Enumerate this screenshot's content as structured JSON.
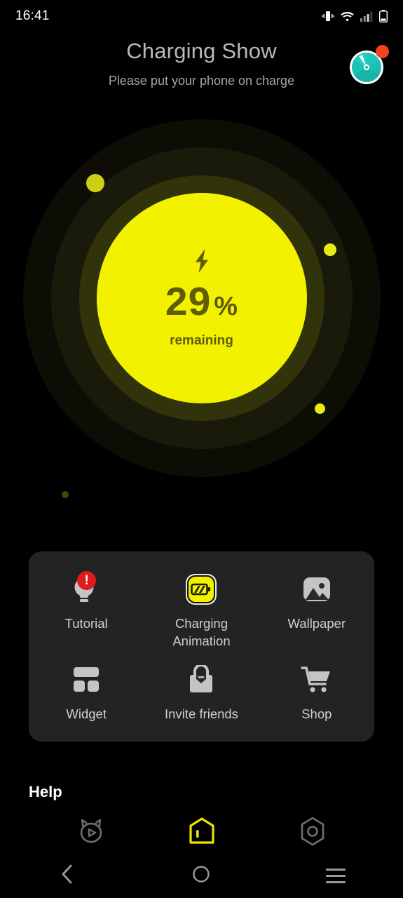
{
  "statusbar": {
    "time": "16:41",
    "icons": [
      "vibrate-icon",
      "wifi-icon",
      "signal-icon",
      "battery-icon"
    ]
  },
  "header": {
    "title": "Charging Show",
    "subtitle": "Please put your phone on charge",
    "badge_icon": "speedometer-icon",
    "badge_dot_color": "#f4431c",
    "badge_color": "#1bbfb4"
  },
  "battery": {
    "percent_value": "29",
    "percent_symbol": "%",
    "label": "remaining",
    "bolt_icon": "lightning-bolt-icon",
    "accent_color": "#f2f200",
    "text_color": "#5e5c06"
  },
  "features": {
    "rows": [
      [
        {
          "label": "Tutorial",
          "icon": "lightbulb-icon",
          "badge": "!"
        },
        {
          "label": "Charging Animation",
          "icon": "battery-charging-icon",
          "badge": ""
        },
        {
          "label": "Wallpaper",
          "icon": "image-icon",
          "badge": ""
        }
      ],
      [
        {
          "label": "Widget",
          "icon": "widget-grid-icon",
          "badge": ""
        },
        {
          "label": "Invite friends",
          "icon": "gift-bag-icon",
          "badge": ""
        },
        {
          "label": "Shop",
          "icon": "shopping-cart-icon",
          "badge": ""
        }
      ]
    ]
  },
  "help": {
    "label": "Help"
  },
  "appnav": {
    "items": [
      {
        "name": "video-cat-icon",
        "active": false
      },
      {
        "name": "home-icon",
        "active": true
      },
      {
        "name": "settings-hex-icon",
        "active": false
      }
    ],
    "active_color": "#ece500",
    "inactive_color": "#6f6f6f"
  },
  "sysnav": {
    "items": [
      "back-icon",
      "home-icon",
      "recents-icon"
    ]
  }
}
